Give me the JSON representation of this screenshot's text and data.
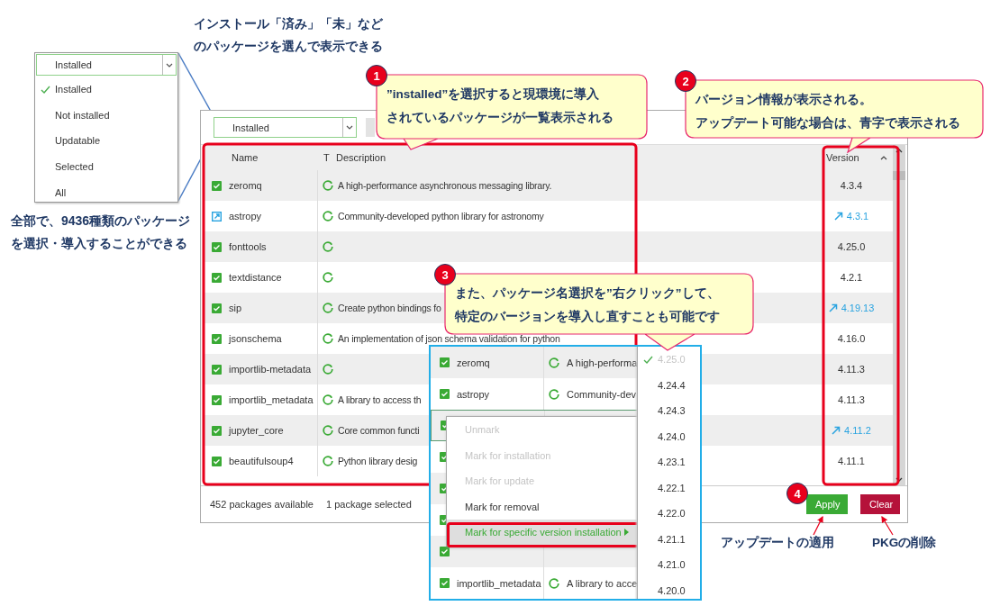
{
  "filter_popup": {
    "value": "Installed",
    "options": [
      {
        "label": "Installed",
        "selected": true
      },
      {
        "label": "Not installed",
        "selected": false
      },
      {
        "label": "Updatable",
        "selected": false
      },
      {
        "label": "Selected",
        "selected": false
      },
      {
        "label": "All",
        "selected": false
      }
    ]
  },
  "notes": [
    {
      "kind": "top",
      "lines": [
        "インストール「済み」「未」など",
        "のパッケージを選んで表示できる"
      ]
    },
    {
      "kind": "left",
      "lines": [
        "全部で、9436種類のパッケージ",
        "を選択・導入することができる"
      ]
    }
  ],
  "window": {
    "filter": {
      "value": "Installed"
    },
    "columns": [
      "Name",
      "T",
      "Description",
      "Version"
    ],
    "rows": [
      {
        "kind": "installed",
        "name": "zeromq",
        "description": "A high-performance asynchronous messaging library.",
        "version": "4.3.4",
        "updatable": false
      },
      {
        "kind": "upgrade",
        "name": "astropy",
        "description": "Community-developed python library for astronomy",
        "version": "4.3.1",
        "updatable": true
      },
      {
        "kind": "installed",
        "name": "fonttools",
        "version": "4.25.0",
        "updatable": false
      },
      {
        "kind": "installed",
        "name": "textdistance",
        "version": "4.2.1",
        "updatable": false
      },
      {
        "kind": "installed",
        "name": "sip",
        "description": "Create python bindings fo",
        "version": "4.19.13",
        "updatable": true
      },
      {
        "kind": "installed",
        "name": "jsonschema",
        "description": "An implementation of json schema validation for python",
        "version": "4.16.0",
        "updatable": false
      },
      {
        "kind": "installed",
        "name": "importlib-metadata",
        "version": "4.11.3",
        "updatable": false
      },
      {
        "kind": "installed",
        "name": "importlib_metadata",
        "description": "A library to access th",
        "version": "4.11.3",
        "updatable": false
      },
      {
        "kind": "installed",
        "name": "jupyter_core",
        "description": "Core common functi",
        "version": "4.11.2",
        "updatable": true
      },
      {
        "kind": "installed",
        "name": "beautifulsoup4",
        "description": "Python library desig",
        "version": "4.11.1",
        "updatable": false
      }
    ],
    "status": [
      "452 packages available",
      "1 package selected"
    ],
    "buttons": [
      {
        "kind": "apply",
        "label": "Apply"
      },
      {
        "kind": "clear",
        "label": "Clear"
      }
    ]
  },
  "callouts": [
    {
      "number": "1",
      "lines": [
        "”installed”を選択すると現環境に導入",
        "されているパッケージが一覧表示される"
      ]
    },
    {
      "number": "2",
      "lines": [
        "バージョン情報が表示される。",
        "アップデート可能な場合は、青字で表示される"
      ]
    },
    {
      "number": "3",
      "lines": [
        "また、パッケージ名選択を”右クリック”して、",
        "特定のバージョンを導入し直すことも可能です"
      ]
    }
  ],
  "step_badge": "4",
  "button_notes": [
    "アップデートの適用",
    "PKGの削除"
  ],
  "context_panel": {
    "rows": [
      {
        "name": "zeromq",
        "description": "A high-performa",
        "selected": false
      },
      {
        "name": "astropy",
        "description": "Community-dev",
        "selected": false
      },
      {
        "selected": true
      },
      {
        "selected": false
      },
      {
        "selected": false
      },
      {
        "selected": false
      },
      {
        "selected": false
      },
      {
        "name": "importlib_metadata",
        "description": "A library to acce",
        "selected": false
      }
    ],
    "menu": [
      {
        "label": "Unmark",
        "disabled": true,
        "highlighted": false
      },
      {
        "label": "Mark for installation",
        "disabled": true,
        "highlighted": false
      },
      {
        "label": "Mark for update",
        "disabled": true,
        "highlighted": false
      },
      {
        "label": "Mark for removal",
        "disabled": false,
        "highlighted": false
      },
      {
        "label": "Mark for specific version installation",
        "disabled": false,
        "highlighted": true
      }
    ],
    "versions": [
      {
        "label": "4.25.0",
        "checked": true
      },
      {
        "label": "4.24.4",
        "checked": false
      },
      {
        "label": "4.24.3",
        "checked": false
      },
      {
        "label": "4.24.0",
        "checked": false
      },
      {
        "label": "4.23.1",
        "checked": false
      },
      {
        "label": "4.22.1",
        "checked": false
      },
      {
        "label": "4.22.0",
        "checked": false
      },
      {
        "label": "4.21.1",
        "checked": false
      },
      {
        "label": "4.21.0",
        "checked": false
      },
      {
        "label": "4.20.0",
        "checked": false
      }
    ]
  }
}
